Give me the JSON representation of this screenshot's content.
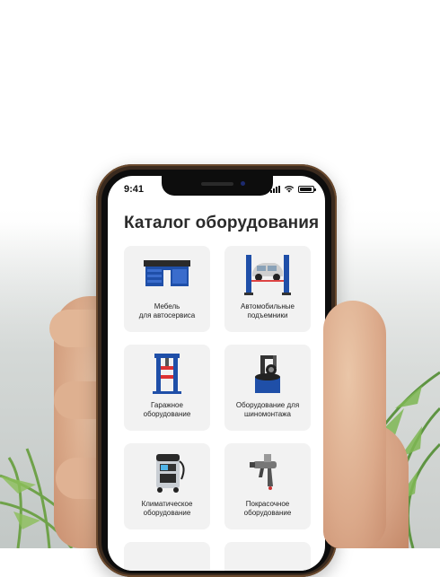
{
  "status_bar": {
    "time": "9:41"
  },
  "catalog": {
    "title": "Каталог оборудования",
    "items": [
      {
        "line1": "Мебель",
        "line2": "для автосервиса",
        "icon": "workbench-icon"
      },
      {
        "line1": "Автомобильные",
        "line2": "подъемники",
        "icon": "car-lift-icon"
      },
      {
        "line1": "Гаражное",
        "line2": "оборудование",
        "icon": "hydraulic-press-icon"
      },
      {
        "line1": "Оборудование для",
        "line2": "шиномонтажа",
        "icon": "tire-changer-icon"
      },
      {
        "line1": "Климатическое",
        "line2": "оборудование",
        "icon": "ac-station-icon"
      },
      {
        "line1": "Покрасочное",
        "line2": "оборудование",
        "icon": "spray-gun-icon"
      }
    ]
  },
  "colors": {
    "accent_blue": "#1f4fa8",
    "card_bg": "#f2f2f2",
    "phone_frame": "#6b4a2e"
  }
}
